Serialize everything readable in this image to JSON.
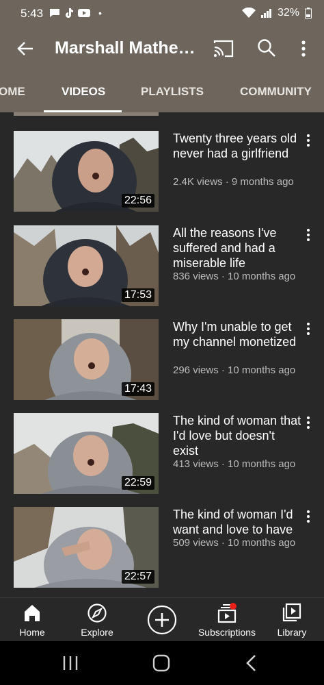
{
  "status_bar": {
    "time": "5:43",
    "battery": "32%"
  },
  "header": {
    "title": "Marshall Mathe…"
  },
  "tabs": [
    {
      "label": "OME"
    },
    {
      "label": "VIDEOS"
    },
    {
      "label": "PLAYLISTS"
    },
    {
      "label": "COMMUNITY"
    }
  ],
  "videos": [
    {
      "title": "Twenty three years old never had a girlfriend",
      "meta": "2.4K views · 9 months ago",
      "duration": "22:56"
    },
    {
      "title": "All the reasons I've suffered and had a miserable life",
      "meta": "836 views · 10 months ago",
      "duration": "17:53"
    },
    {
      "title": "Why I'm unable to get my channel monetized",
      "meta": "296 views · 10 months ago",
      "duration": "17:43"
    },
    {
      "title": "The kind of woman that I'd love but doesn't exist",
      "meta": "413 views · 10 months ago",
      "duration": "22:59"
    },
    {
      "title": "The kind of woman I'd want and love to have",
      "meta": "509 views · 10 months ago",
      "duration": "22:57"
    }
  ],
  "bottom_nav": [
    {
      "label": "Home",
      "icon": "home-icon"
    },
    {
      "label": "Explore",
      "icon": "compass-icon"
    },
    {
      "label": "",
      "icon": "add-icon"
    },
    {
      "label": "Subscriptions",
      "icon": "subscriptions-icon"
    },
    {
      "label": "Library",
      "icon": "library-icon"
    }
  ],
  "colors": {
    "header_bg": "#6e665d",
    "content_bg": "#282828",
    "notification_dot": "#e62117"
  }
}
